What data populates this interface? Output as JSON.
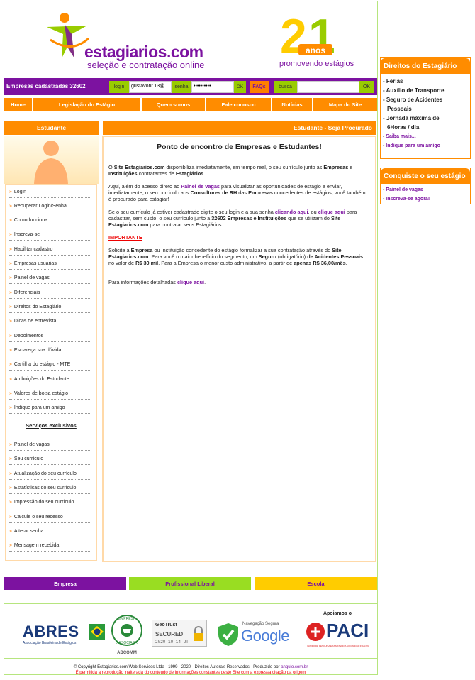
{
  "header": {
    "logo_text": "estagiarios.com",
    "logo_tagline": "seleção e contratação online",
    "anniversary_number": "21",
    "anniversary_word": "anos",
    "anniversary_tagline": "promovendo estágios"
  },
  "topbar": {
    "companies_count": "Empresas cadastradas 32602",
    "login_label": "login",
    "login_value": "gustavonr.13@",
    "password_label": "senha",
    "password_value": "••••••••••",
    "ok_label": "OK",
    "faq_label": "FAQs",
    "search_label": "busca",
    "search_value": "",
    "search_ok_label": "OK"
  },
  "nav": [
    "Home",
    "Legislação do Estágio",
    "Quem somos",
    "Fale conosco",
    "Notícias",
    "Mapa do Site"
  ],
  "sidebar": {
    "title": "Estudante",
    "links": [
      "Login",
      "Recuperar Login/Senha",
      "Como funciona",
      "Inscreva-se",
      "Habilitar cadastro",
      "Empresas usuárias",
      "Painel de vagas",
      "Diferenciais",
      "Direitos do Estagiário",
      "Dicas de entrevista",
      "Depoimentos",
      "Esclareça sua dúvida",
      "Cartilha do estágio - MTE",
      "Atribuições do Estudante",
      "Valores de bolsa estágio",
      "Indique para um amigo"
    ],
    "services_title": "Serviços exclusivos",
    "services": [
      "Painel de vagas",
      "Seu currículo",
      "Atualização do seu currículo",
      "Estatísticas do seu currículo",
      "Impressão do seu currículo",
      "Calcule o seu recesso",
      "Alterar senha",
      "Mensagem recebida"
    ]
  },
  "content": {
    "section_title": "Estudante - Seja Procurado",
    "heading": "Ponto de encontro de Empresas e Estudantes!",
    "p1": {
      "a": "O ",
      "b": "Site Estagiarios.com",
      "c": " disponibiliza imediatamente, em tempo real, o seu currículo junto às ",
      "d": "Empresas",
      "e": " e ",
      "f": "Instituições",
      "g": " contratantes de ",
      "h": "Estagiários",
      "i": "."
    },
    "p2": {
      "a": "Aqui, além do acesso direto ao ",
      "link": "Painel de vagas",
      "b": " para visualizar as oportunidades de estágio e enviar, imediatamente, o seu currículo aos ",
      "c": "Consultores de RH",
      "d": " das ",
      "e": "Empresas",
      "f": " concedentes de estágios, você também é procurado para estagiar!"
    },
    "p3": {
      "a": "Se o seu currículo já estiver cadastrado digite o seu login e a sua senha ",
      "link1": "clicando aqui",
      "b": ", ou ",
      "link2": "clique aqui",
      "c": " para cadastrar, ",
      "d": "sem custo",
      "e": ", o seu currículo junto a ",
      "f": "32602 Empresas e Instituições",
      "g": " que se utilizam do ",
      "h": "Site Estagiarios.com",
      "i": " para contratar seus Estagiários."
    },
    "important": "IMPORTANTE",
    "p4": {
      "a": "Solicite à ",
      "b": "Empresa",
      "c": " ou Instituição concedente do estágio formalizar a sua contratação através do ",
      "d": "Site Estagiarios.com",
      "e": ". Para você o maior benefício do segmento, um ",
      "f": "Seguro",
      "g": " (obrigatório) ",
      "h": "de Acidentes Pessoais",
      "i": " no valor de ",
      "j": "R$ 30 mil",
      "k": ". Para a Empresa o menor custo administrativo, a partir de ",
      "l": "apenas R$ 36,00/mês",
      "m": "."
    },
    "p5": {
      "a": "Para informações detalhadas ",
      "link": "clique aqui",
      "b": "."
    }
  },
  "bottom_bar": [
    "Empresa",
    "Profissional Liberal",
    "Escola"
  ],
  "partners": {
    "abres": "ABRES",
    "abres_sub": "Associação Brasileira de Estágios",
    "abcomm_top": "EMPRESA",
    "abcomm_mid": "ASSOCIADA",
    "abcomm_name": "ABCOMM",
    "geotrust": "GeoTrust",
    "geotrust_secured": "SECURED",
    "geotrust_date": "2020-10-14 UT",
    "google_top": "Navegação Segura",
    "google": "Google",
    "supporters_label": "Apoiamos o",
    "paci": "PACI",
    "paci_sub": "GRUPO DE PESQUISA E ASSISTÊNCIA AO CÂNCER INFANTIL"
  },
  "footer": {
    "copyright": "© Copyright Estagiarios.com Web Services Ltda - 1999 - 2020 - Direitos Autorais Reservados - Produzido por ",
    "author": "angulo.com.br",
    "notice": "É permitida a reprodução inalterada do conteúdo de informações constantes deste Site com a expressa citação da origem"
  },
  "right": {
    "rights_title": "Direitos do Estagiário",
    "rights": [
      "Férias",
      "Auxílio de Transporte",
      "Seguro de Acidentes",
      "Pessoais",
      "Jornada máxima de",
      "6Horas / dia"
    ],
    "rights_links": [
      "Saiba mais...",
      "Indique para um amigo"
    ],
    "conquest_title": "Conquiste o seu estágio",
    "conquest_links": [
      "Painel de vagas",
      "Inscreva-se agora!"
    ]
  },
  "colors": {
    "purple": "#7c12a0",
    "orange": "#ff8c00",
    "green": "#99cc00",
    "yellow": "#ffcc00"
  }
}
